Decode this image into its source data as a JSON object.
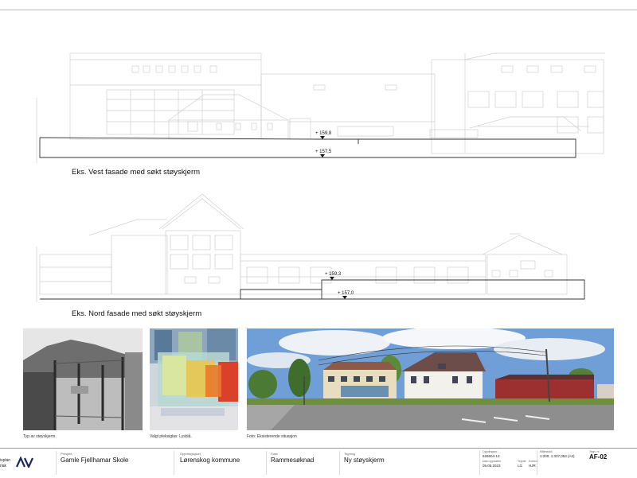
{
  "drawing_west": {
    "caption": "Eks. Vest fasade med søkt støyskjerm",
    "elev_top": "+ 159,8",
    "elev_bottom": "+ 157,5"
  },
  "drawing_north": {
    "caption": "Eks. Nord fasade med søkt støyskjerm",
    "elev_top": "+ 159,3",
    "elev_bottom": "+ 157,0"
  },
  "photos": [
    {
      "caption": "Typ av støyskjerm."
    },
    {
      "caption": "Valgt pleksiglas: Lysbiå."
    },
    {
      "caption": "Foto: Eksisterende situasjon"
    }
  ],
  "titleblock": {
    "logo_text_1": "isplan",
    "logo_text_2": "riak",
    "prosjekt_label": "Prosjekt",
    "prosjekt": "Gamle Fjellhamar Skole",
    "oppdragsgiver_label": "Oppdragsgiver",
    "oppdragsgiver": "Lørenskog kommune",
    "fase_label": "Fase",
    "fase": "Rammesøknad",
    "tegning_label": "Tegning",
    "tegning": "Ny støyskjerm",
    "oppdrag_label": "Oppdragsnr.",
    "oppdrag": "626504-13",
    "dato_label": "Dato oppdatert",
    "dato": "05.05.2023",
    "tegnet_label": "Tegnet",
    "tegnet": "LG",
    "kontroll_label": "Kontroll",
    "kontroll": "HJR",
    "malestokk_label": "Målestokk",
    "malestokk": "1:200, 1:337,053 (A3)",
    "tegnnr_label": "Tegn. nr.",
    "tegnnr": "AF-02"
  }
}
